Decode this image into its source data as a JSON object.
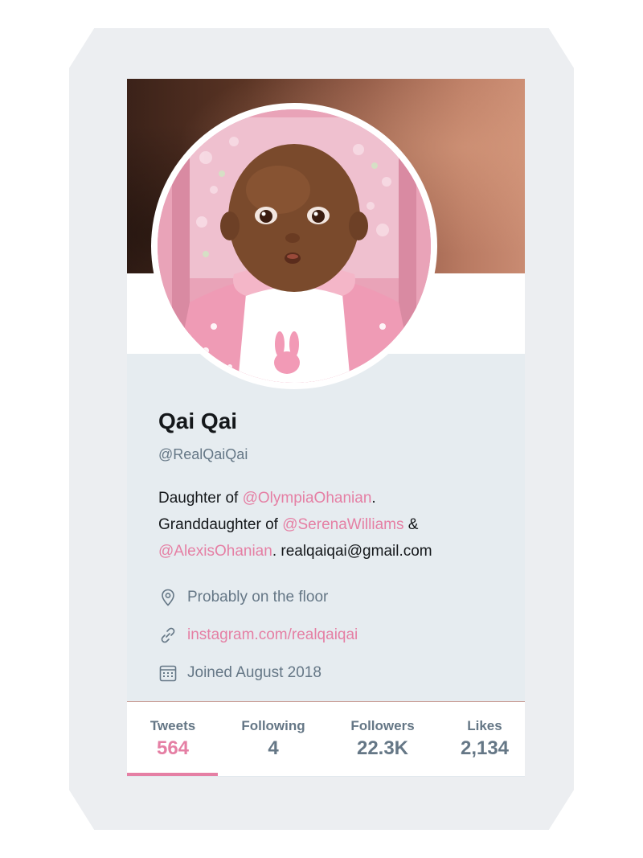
{
  "profile": {
    "name": "Qai Qai",
    "handle": "@RealQaiQai",
    "bio": {
      "line1_prefix": "Daughter of ",
      "line1_mention": "@OlympiaOhanian",
      "line1_suffix": ".",
      "line2_prefix": "Granddaughter of ",
      "line2_mention": "@SerenaWilliams",
      "line2_suffix": " &",
      "line3_mention": "@AlexisOhanian",
      "line3_suffix": ". realqaiqai@gmail.com"
    },
    "location": "Probably on the floor",
    "website": "instagram.com/realqaiqai",
    "joined": "Joined August 2018"
  },
  "icons": {
    "location": "location-pin-icon",
    "website": "link-icon",
    "joined": "calendar-icon"
  },
  "stats": [
    {
      "label": "Tweets",
      "value": "564",
      "active": true
    },
    {
      "label": "Following",
      "value": "4",
      "active": false
    },
    {
      "label": "Followers",
      "value": "22.3K",
      "active": false
    },
    {
      "label": "Likes",
      "value": "2,134",
      "active": false
    }
  ],
  "colors": {
    "accent": "#e57fa4",
    "muted_text": "#657786",
    "primary_text": "#14171a",
    "card_bg": "#e6ecf0"
  }
}
